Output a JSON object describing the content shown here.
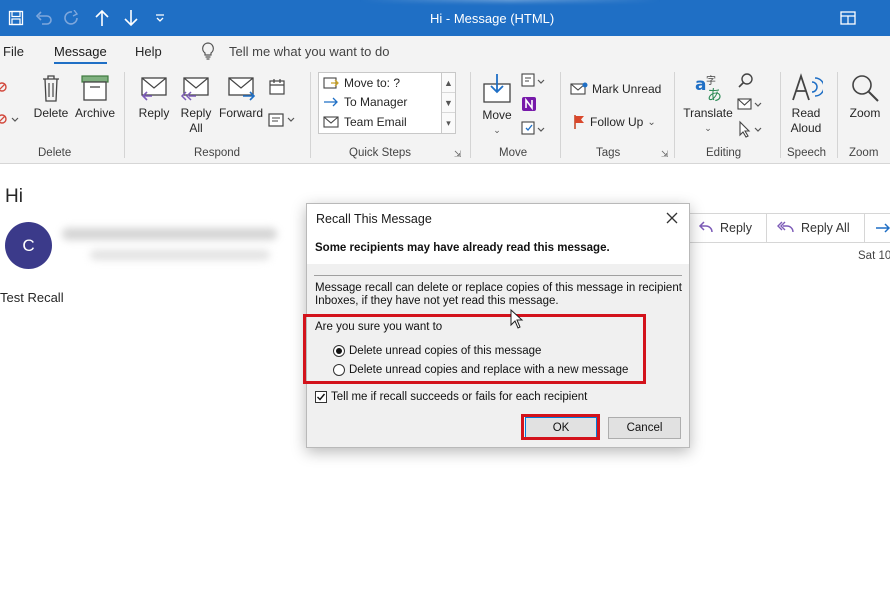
{
  "window": {
    "title": "Hi  -  Message (HTML)"
  },
  "tabs": [
    {
      "label": "File"
    },
    {
      "label": "Message"
    },
    {
      "label": "Help"
    }
  ],
  "tellme": {
    "placeholder": "Tell me what you want to do"
  },
  "ribbon": {
    "delete_group": {
      "label": "Delete",
      "delete": "Delete",
      "archive": "Archive"
    },
    "respond_group": {
      "label": "Respond",
      "reply": "Reply",
      "reply_all_1": "Reply",
      "reply_all_2": "All",
      "forward": "Forward"
    },
    "quick_steps": {
      "label": "Quick Steps",
      "items": [
        "Move to: ?",
        "To Manager",
        "Team Email"
      ]
    },
    "move_group": {
      "label": "Move",
      "move": "Move"
    },
    "tags_group": {
      "label": "Tags",
      "mark_unread": "Mark Unread",
      "follow_up": "Follow Up"
    },
    "editing_group": {
      "label": "Editing",
      "translate": "Translate"
    },
    "speech_group": {
      "label": "Speech",
      "read_aloud_1": "Read",
      "read_aloud_2": "Aloud"
    },
    "zoom_group": {
      "label": "Zoom",
      "zoom": "Zoom"
    }
  },
  "message": {
    "subject": "Hi",
    "avatar_initial": "C",
    "body": "Test Recall",
    "actions": {
      "reply": "Reply",
      "reply_all": "Reply All"
    },
    "date": "Sat 10/"
  },
  "dialog": {
    "title": "Recall This Message",
    "warning": "Some recipients may have already read this message.",
    "description": "Message recall can delete or replace copies of this message in recipient Inboxes, if they have not yet read this message.",
    "question": "Are you sure you want to",
    "options": [
      {
        "label": "Delete unread copies of this message",
        "selected": true
      },
      {
        "label": "Delete unread copies and replace with a new message",
        "selected": false
      }
    ],
    "notify": {
      "label": "Tell me if recall succeeds or fails for each recipient",
      "checked": true
    },
    "ok": "OK",
    "cancel": "Cancel"
  },
  "colors": {
    "titlebar": "#1f6fc5",
    "highlight": "#d3121b",
    "avatar": "#3b3a8a"
  }
}
